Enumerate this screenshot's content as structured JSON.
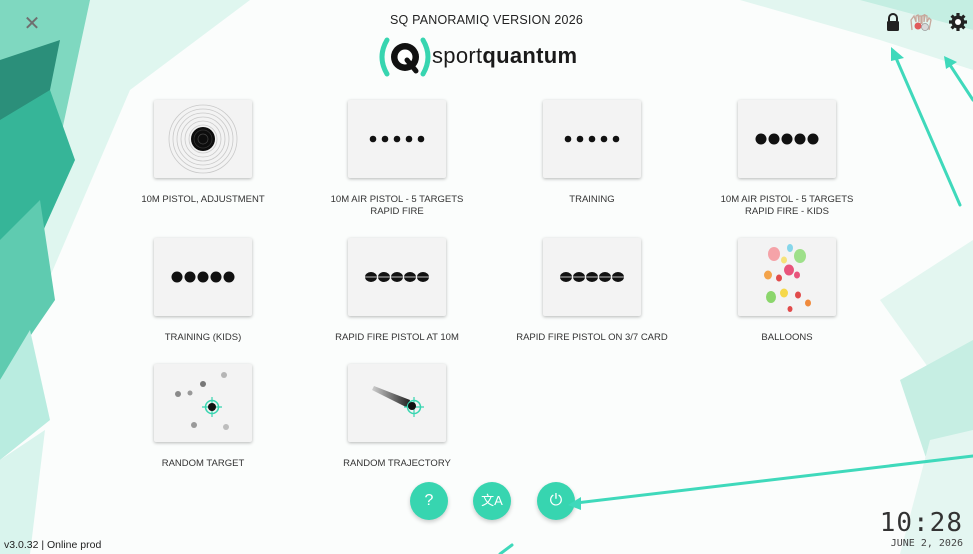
{
  "header": {
    "title": "SQ PANORAMIQ VERSION 2026",
    "logo_text_light": "sport",
    "logo_text_bold": "quantum"
  },
  "top_icons": [
    {
      "name": "lock-icon"
    },
    {
      "name": "hands-icon"
    },
    {
      "name": "settings-gear-icon"
    }
  ],
  "tiles": [
    {
      "label": "10M PISTOL, ADJUSTMENT",
      "label2": "",
      "icon": "target-icon"
    },
    {
      "label": "10M AIR PISTOL - 5 TARGETS",
      "label2": "RAPID FIRE",
      "icon": "five-dots-small-icon"
    },
    {
      "label": "TRAINING",
      "label2": "",
      "icon": "five-dots-small-icon"
    },
    {
      "label": "10M AIR PISTOL - 5 TARGETS",
      "label2": "RAPID FIRE - KIDS",
      "icon": "five-dots-large-icon"
    },
    {
      "label": "TRAINING (KIDS)",
      "label2": "",
      "icon": "five-dots-large-icon"
    },
    {
      "label": "RAPID FIRE PISTOL AT 10M",
      "label2": "",
      "icon": "five-striped-dots-icon"
    },
    {
      "label": "RAPID FIRE PISTOL ON 3/7 CARD",
      "label2": "",
      "icon": "five-striped-dots-icon"
    },
    {
      "label": "BALLOONS",
      "label2": "",
      "icon": "balloons-icon"
    },
    {
      "label": "RANDOM TARGET",
      "label2": "",
      "icon": "random-target-icon"
    },
    {
      "label": "RANDOM TRAJECTORY",
      "label2": "",
      "icon": "random-trajectory-icon"
    }
  ],
  "bottom_buttons": [
    {
      "name": "help-button",
      "glyph": "?"
    },
    {
      "name": "translate-button",
      "glyph": "文A"
    },
    {
      "name": "power-button",
      "glyph": "⏻"
    }
  ],
  "footer": {
    "version": "v3.0.32 | Online prod",
    "time": "10:28",
    "date": "JUNE 2, 2026"
  },
  "colors": {
    "accent": "#37d5b0",
    "annotation_arrow": "#3fd9bb"
  }
}
